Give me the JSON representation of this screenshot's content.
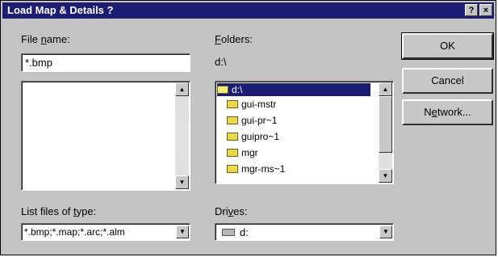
{
  "dialog": {
    "title": "Load Map & Details ?",
    "help_btn": "?",
    "close_btn": "×"
  },
  "file_name": {
    "label_pre": "File ",
    "label_key": "n",
    "label_post": "ame:",
    "value": "*.bmp"
  },
  "folders": {
    "label_key": "F",
    "label_post": "olders:",
    "current_path": "d:\\",
    "items": [
      {
        "name": "d:\\",
        "icon": "open-folder",
        "selected": true
      },
      {
        "name": "gui-mstr",
        "icon": "folder",
        "selected": false
      },
      {
        "name": "gui-pr~1",
        "icon": "folder",
        "selected": false
      },
      {
        "name": "guipro~1",
        "icon": "folder",
        "selected": false
      },
      {
        "name": "mgr",
        "icon": "folder",
        "selected": false
      },
      {
        "name": "mgr-ms~1",
        "icon": "folder",
        "selected": false
      }
    ]
  },
  "file_type": {
    "label_pre": "List files of ",
    "label_key": "t",
    "label_post": "ype:",
    "value": "*.bmp;*.map;*.arc;*.alm"
  },
  "drives": {
    "label_pre": "Dri",
    "label_key": "v",
    "label_post": "es:",
    "value": "d:",
    "icon": "drive"
  },
  "buttons": {
    "ok": "OK",
    "cancel": "Cancel",
    "network_pre": "N",
    "network_key": "e",
    "network_post": "twork..."
  }
}
